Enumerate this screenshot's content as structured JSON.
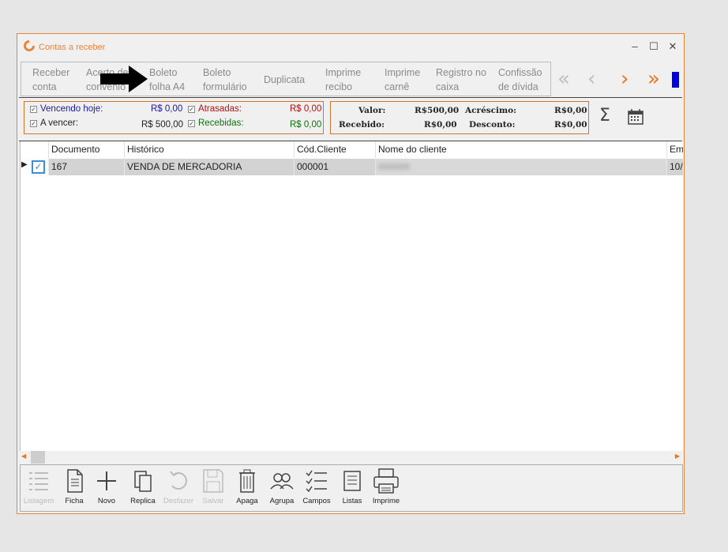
{
  "window": {
    "title": "Contas a receber",
    "accent": "#e8853a"
  },
  "toolbar": {
    "items": [
      {
        "label": "Receber\nconta"
      },
      {
        "label": "Acerto de\nconvênio"
      },
      {
        "label": "Boleto\nfolha A4"
      },
      {
        "label": "Boleto\nformulário"
      },
      {
        "label": "Duplicata"
      },
      {
        "label": "Imprime\nrecibo"
      },
      {
        "label": "Imprime\ncarnê"
      },
      {
        "label": "Registro no\ncaixa"
      },
      {
        "label": "Confissão\nde dívida"
      }
    ]
  },
  "nav": {
    "first": "«",
    "prev": "‹",
    "next": "›",
    "last": "»"
  },
  "filters": {
    "vencendo_label": "Vencendo hoje:",
    "vencendo_value": "R$ 0,00",
    "avencer_label": "A vencer:",
    "avencer_value": "R$ 500,00",
    "atrasadas_label": "Atrasadas:",
    "atrasadas_value": "R$ 0,00",
    "recebidas_label": "Recebidas:",
    "recebidas_value": "R$ 0,00"
  },
  "totals": {
    "valor_label": "Valor:",
    "valor_value": "R$500,00",
    "recebido_label": "Recebido:",
    "recebido_value": "R$0,00",
    "acrescimo_label": "Acréscimo:",
    "acrescimo_value": "R$0,00",
    "desconto_label": "Desconto:",
    "desconto_value": "R$0,00"
  },
  "grid": {
    "columns": [
      "Documento",
      "Histórico",
      "Cód.Cliente",
      "Nome do cliente",
      "Em"
    ],
    "rows": [
      {
        "documento": "167",
        "historico": "VENDA DE MERCADORIA",
        "cod_cliente": "000001",
        "nome": "",
        "em": "10/"
      }
    ]
  },
  "bottom": {
    "items": [
      "Listagem",
      "Ficha",
      "Novo",
      "Replica",
      "Desfazer",
      "Salvar",
      "Apaga",
      "Agrupa",
      "Campos",
      "Listas",
      "Imprime"
    ]
  }
}
